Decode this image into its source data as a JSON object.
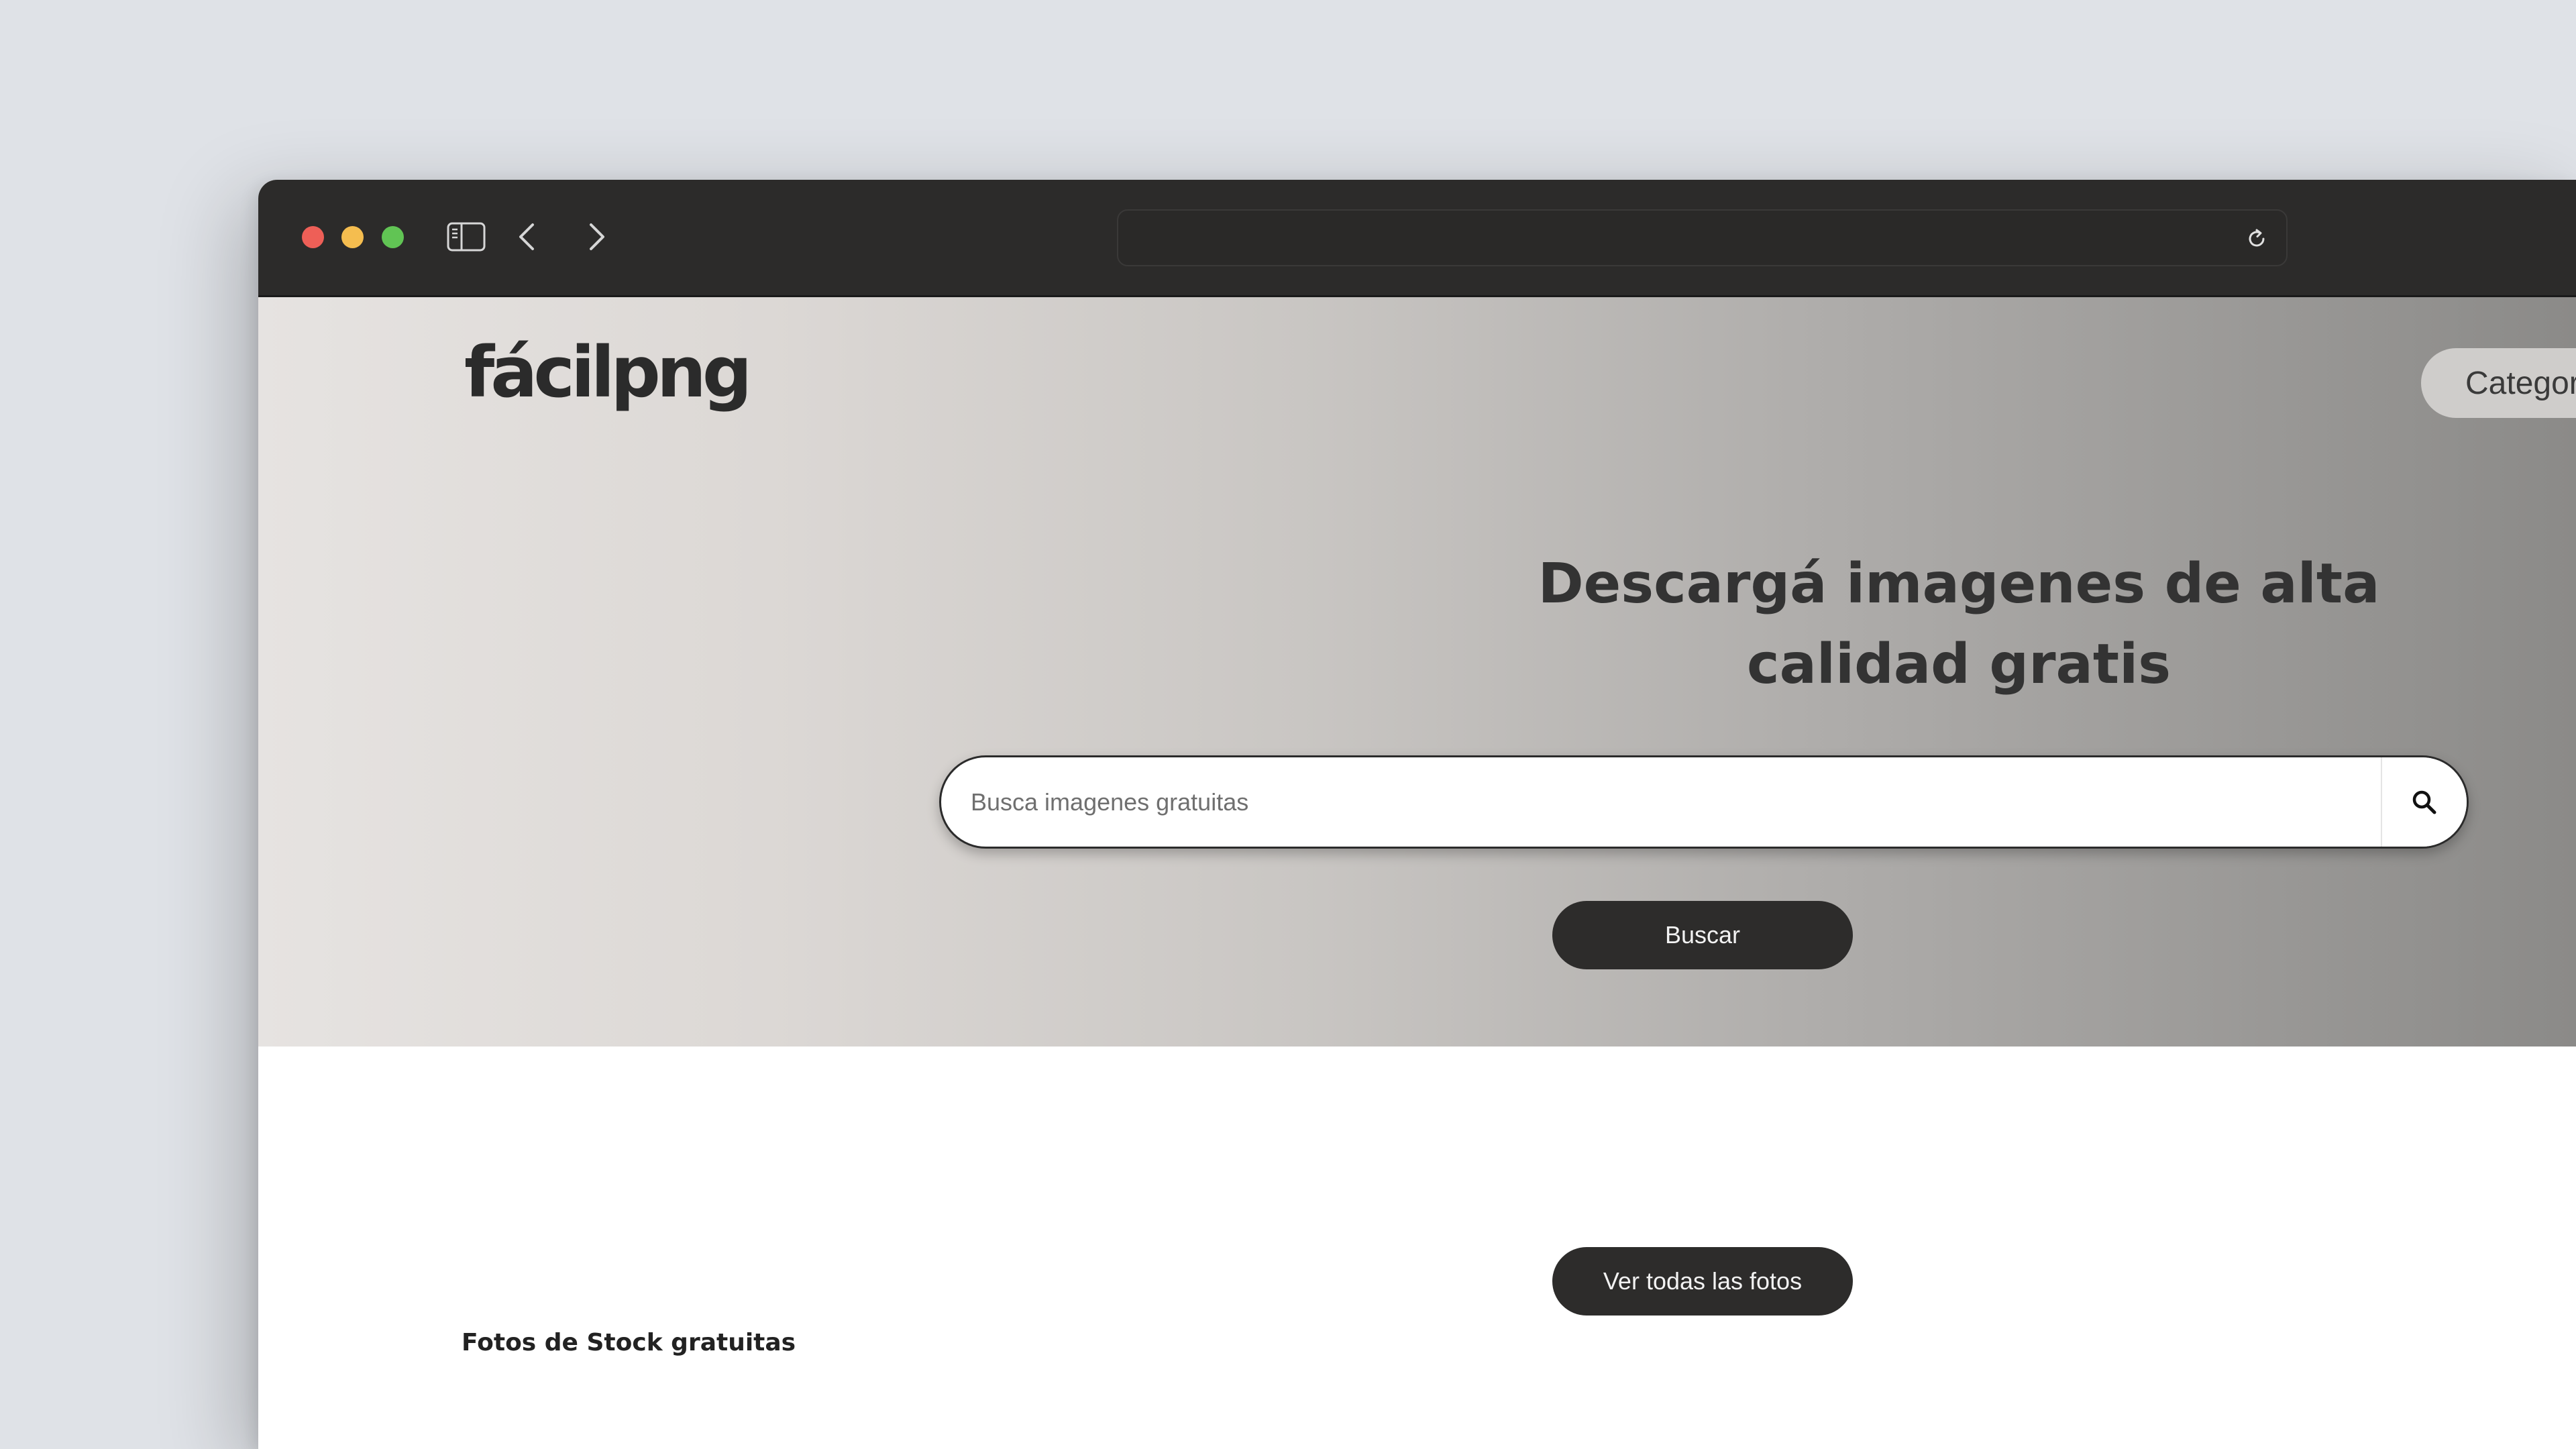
{
  "browser": {
    "window_controls": [
      "close",
      "minimize",
      "maximize"
    ],
    "toolbar_icons": [
      "sidebar-icon",
      "chevron-left-icon",
      "chevron-right-icon",
      "reload-icon"
    ],
    "address_bar": {
      "value": ""
    }
  },
  "header": {
    "logo_text": "fácilpng",
    "categories_label": "Categor"
  },
  "hero": {
    "title_line1": "Descargá imagenes de alta",
    "title_line2": "calidad gratis",
    "search": {
      "placeholder": "Busca imagenes gratuitas",
      "value": ""
    },
    "search_button_label": "Buscar"
  },
  "main": {
    "view_all_label": "Ver todas las fotos",
    "section_title": "Fotos de Stock gratuitas"
  },
  "colors": {
    "titlebar": "#2c2b2a",
    "button_dark": "#2d2c2b",
    "close": "#ee5f57",
    "minimize": "#f5bd4f",
    "maximize": "#61c454"
  }
}
